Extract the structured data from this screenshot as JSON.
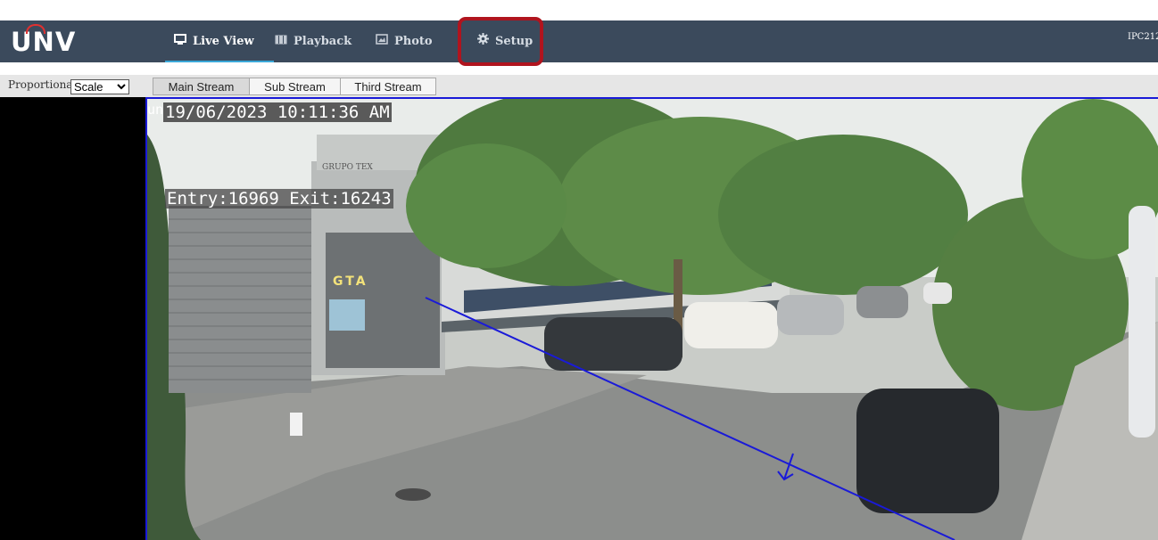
{
  "brand": {
    "logo_text": "UNV",
    "accent": "#e03030"
  },
  "nav": {
    "items": [
      {
        "label": "Live View",
        "icon": "monitor-icon",
        "active": true
      },
      {
        "label": "Playback",
        "icon": "film-icon",
        "active": false
      },
      {
        "label": "Photo",
        "icon": "photo-icon",
        "active": false
      },
      {
        "label": "Setup",
        "icon": "gear-icon",
        "active": false
      }
    ],
    "device_name": "IPC212"
  },
  "toolbar": {
    "proportional_label": "Proportional",
    "scale_value": "Scale",
    "streams": [
      {
        "label": "Main Stream",
        "active": true
      },
      {
        "label": "Sub Stream",
        "active": false
      },
      {
        "label": "Third Stream",
        "active": false
      }
    ]
  },
  "video": {
    "watermark": "unv",
    "timestamp": "19/06/2023 10:11:36 AM",
    "counter": "Entry:16969 Exit:16243",
    "sign_text": "GTA",
    "building_text": "GRUPO TEX",
    "line_color": "#1a1ad8"
  },
  "colors": {
    "navbar": "#3b4a5c",
    "highlight": "#b0141e",
    "active_underline": "#3aa8d8"
  }
}
